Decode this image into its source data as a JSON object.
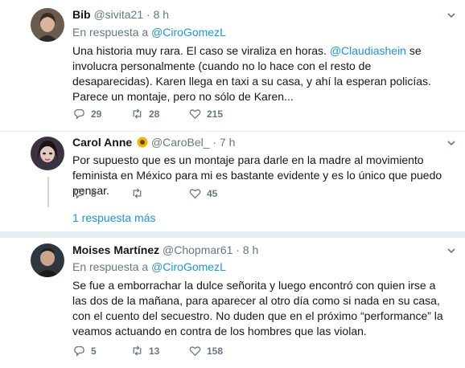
{
  "tweets": [
    {
      "name": "Bib",
      "handle": "@sivita21",
      "dot": "·",
      "time": "8 h",
      "reply_prefix": "En respuesta a ",
      "reply_to": "@CiroGomezL",
      "text_before": "Una historia muy rara. El caso se viraliza en horas. ",
      "text_mention": "@Claudiashein",
      "text_after": " se involucra personalmente (cuando no lo hace con el resto de desaparecidas). Karen llega en taxi a su casa, y ahí la esperan policías. Parece un montaje, pero no sólo de Karen...",
      "replies": "29",
      "retweets": "28",
      "likes": "215"
    },
    {
      "name": "Carol Anne",
      "emoji": "sunflower-emoji",
      "handle": "@CaroBel_",
      "dot": "·",
      "time": "7 h",
      "text": "Por supuesto que es un montaje para darle en la madre al movimiento feminista en México para mi es bastante evidente y es lo único que puedo pensar.",
      "replies": "8",
      "retweets": "",
      "likes": "45",
      "more_replies": "1 respuesta más"
    },
    {
      "name": "Moises Martínez",
      "handle": "@Chopmar61",
      "dot": "·",
      "time": "8 h",
      "reply_prefix": "En respuesta a ",
      "reply_to": "@CiroGomezL",
      "text": "Se fue a emborrachar la dulce señorita y luego encontró con quien irse a las dos de la mañana, para aparecer al otro día como si nada en su casa, con el cuento del secuestro. No duden que en el próximo “performance” la veamos actuando en contra de los hombres que las violan.",
      "replies": "5",
      "retweets": "13",
      "likes": "158"
    }
  ],
  "colors": {
    "link": "#1b95e0",
    "muted": "#657786",
    "text": "#14171a",
    "divider": "#e6ecf0"
  },
  "icons": [
    "reply-icon",
    "retweet-icon",
    "like-icon",
    "caret-down-icon"
  ]
}
